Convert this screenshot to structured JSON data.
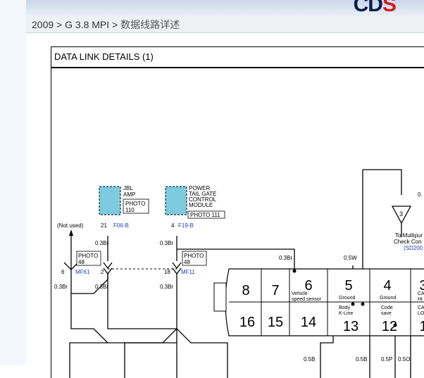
{
  "header": {
    "logo": {
      "main": "CD",
      "accent": "S"
    },
    "colors": {
      "banner": "#c7d6e8",
      "logo": "#0b1c4a",
      "logo_accent": "#d41b1b"
    }
  },
  "breadcrumb": {
    "year": "2009",
    "separator1": " > ",
    "model": "G 3.8 MPI",
    "separator2": " > ",
    "current": "数据线路详述"
  },
  "diagram": {
    "title": "DATA LINK DETAILS (1)",
    "components": {
      "jbl_amp": {
        "name_line1": "JBL",
        "name_line2": "AMP",
        "photo_line1": "PHOTO",
        "photo_line2": "110",
        "pin": "21",
        "connector": "F06-B"
      },
      "power_tailgate": {
        "name_line1": "POWER",
        "name_line2": "TAIL GATE",
        "name_line3": "CONTROL",
        "name_line4": "MODULE",
        "photo": "PHOTO 111",
        "pin": "4",
        "connector": "F19-B"
      }
    },
    "not_used": "(Not used)",
    "wires": {
      "w1": "0.3Br",
      "w2": "0.3Br",
      "w3": "0.3Br",
      "w4": "0.3Br",
      "w5": "0.3Br",
      "w6": "0.3Br",
      "w7": "0.3Br",
      "w8": "0.5W",
      "b1": "0.5B",
      "b2": "0.5B",
      "b3": "0.5P",
      "b4": "0.5O"
    },
    "splices": {
      "mf61_photo_line1": "PHOTO",
      "mf61_photo_line2": "48",
      "mf61_pin": "6",
      "mf61_connector": "MF61",
      "mf61_pin2": "2",
      "mf11_photo_line1": "PHOTO",
      "mf11_photo_line2": "48",
      "mf11_pin": "18",
      "mf11_connector": "MF11"
    },
    "dlc": {
      "top_pins": [
        "8",
        "7",
        "6",
        "5",
        "4",
        "3"
      ],
      "bottom_pins": [
        "16",
        "15",
        "14",
        "13",
        "12",
        "1"
      ],
      "labels": {
        "p6_line1": "Vehicle",
        "p6_line2": "speed sensor",
        "p5": "Ground",
        "p4": "Ground",
        "p3_line1": "CA",
        "p3_line2": "HI",
        "p13_line1": "Body",
        "p13_line2": "K-Line",
        "p12_line1": "Code",
        "p12_line2": "save",
        "p1_line1": "CA",
        "p1_line2": "LO"
      }
    },
    "reference": {
      "circle": "3",
      "line1": "To Multipur",
      "line2": "Check Con",
      "code": "(SD200",
      "partial": "0."
    }
  }
}
